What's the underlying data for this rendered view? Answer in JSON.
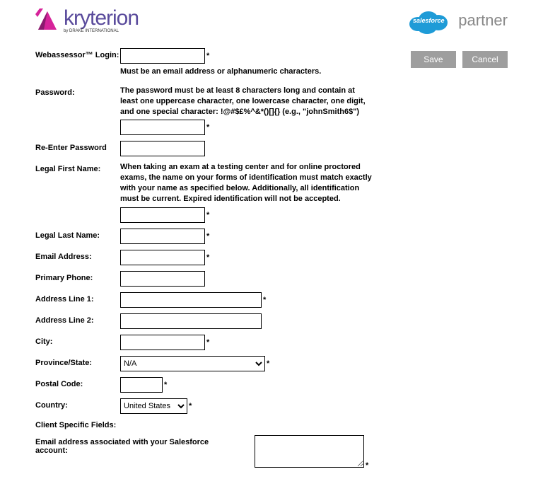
{
  "header": {
    "brand": "kryterion",
    "brand_sub": "by DRAKE INTERNATIONAL",
    "cloud_text": "salesforce",
    "partner": "partner"
  },
  "buttons": {
    "save": "Save",
    "cancel": "Cancel"
  },
  "form": {
    "login_label": "Webassessor™ Login:",
    "login_hint": "Must be an email address or alphanumeric characters.",
    "password_label": "Password:",
    "password_hint": "The password must be at least 8 characters long and contain at least one uppercase character, one lowercase character, one digit, and one special character: !@#$£%^&*()[]{} (e.g., \"johnSmith6$\")",
    "reenter_label": "Re-Enter Password",
    "first_name_label": "Legal First Name:",
    "first_name_hint": "When taking an exam at a testing center and for online proctored exams, the name on your forms of identification must match exactly with your name as specified below. Additionally, all identification must be current. Expired identification will not be accepted.",
    "last_name_label": "Legal Last Name:",
    "email_label": "Email Address:",
    "phone_label": "Primary Phone:",
    "addr1_label": "Address Line 1:",
    "addr2_label": "Address Line 2:",
    "city_label": "City:",
    "province_label": "Province/State:",
    "province_value": "N/A",
    "postal_label": "Postal Code:",
    "country_label": "Country:",
    "country_value": "United States",
    "client_section": "Client Specific Fields:",
    "sf_email_label": "Email address associated with your Salesforce account:",
    "asterisk": "*"
  }
}
